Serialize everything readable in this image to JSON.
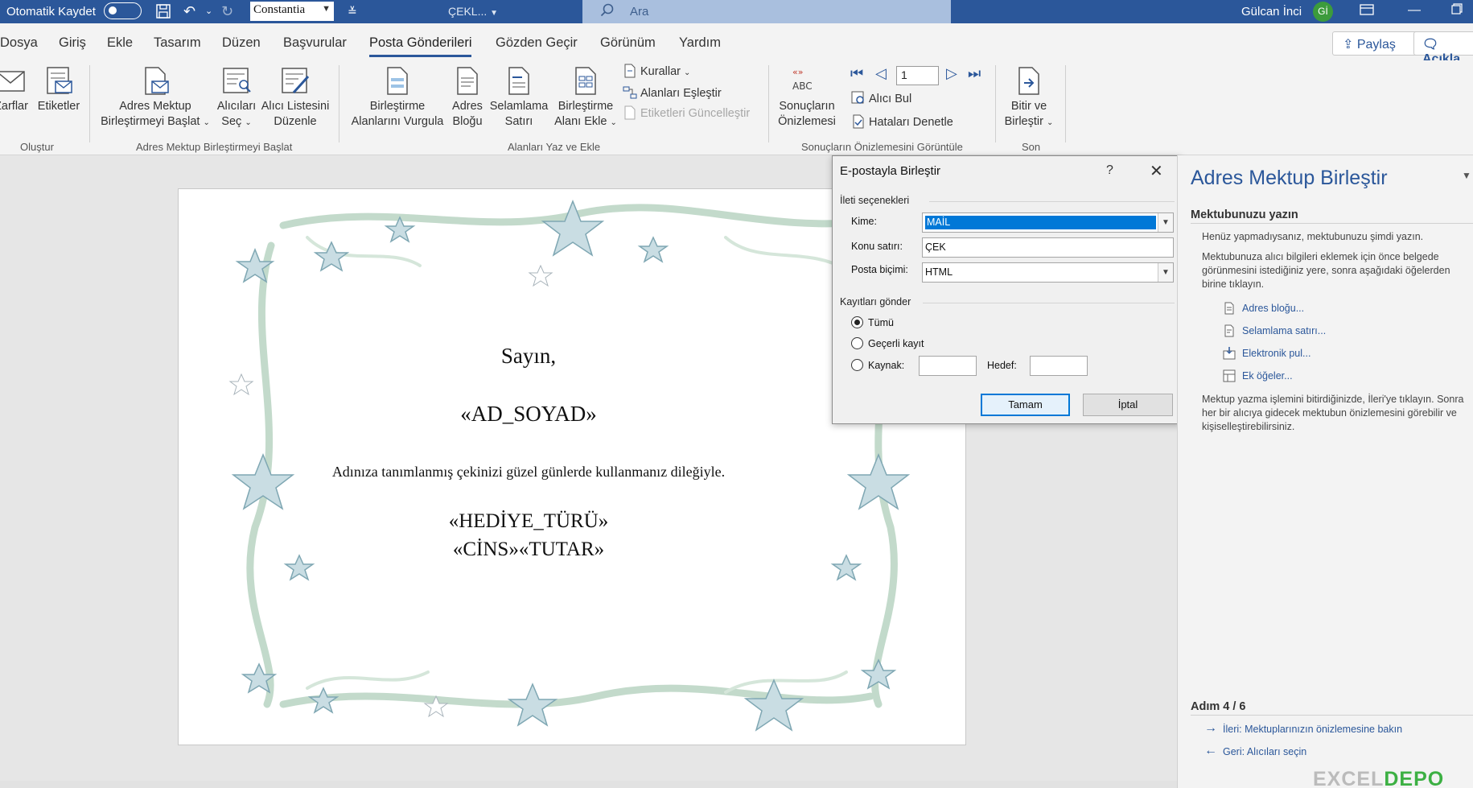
{
  "titlebar": {
    "autosave_label": "Otomatik Kaydet",
    "font_name": "Constantia",
    "doc_name": "ÇEKL...",
    "search_placeholder": "Ara",
    "user_name": "Gülcan İnci",
    "user_initials": "Gİ"
  },
  "tabs": [
    {
      "label": "Dosya"
    },
    {
      "label": "Giriş"
    },
    {
      "label": "Ekle"
    },
    {
      "label": "Tasarım"
    },
    {
      "label": "Düzen"
    },
    {
      "label": "Başvurular"
    },
    {
      "label": "Posta Gönderileri",
      "active": true
    },
    {
      "label": "Gözden Geçir"
    },
    {
      "label": "Görünüm"
    },
    {
      "label": "Yardım"
    }
  ],
  "header_actions": {
    "share": "Paylaş",
    "comments": "Açıkla"
  },
  "ribbon": {
    "create": {
      "envelopes": "Zarflar",
      "labels": "Etiketler",
      "group": "Oluştur"
    },
    "start": {
      "start_merge": [
        "Adres Mektup",
        "Birleştirmeyi Başlat"
      ],
      "select_recipients": [
        "Alıcıları",
        "Seç"
      ],
      "edit_list": [
        "Alıcı Listesini",
        "Düzenle"
      ],
      "group": "Adres Mektup Birleştirmeyi Başlat"
    },
    "write": {
      "highlight": [
        "Birleştirme",
        "Alanlarını Vurgula"
      ],
      "address_block": [
        "Adres",
        "Bloğu"
      ],
      "greeting_line": [
        "Selamlama",
        "Satırı"
      ],
      "insert_field": [
        "Birleştirme",
        "Alanı Ekle"
      ],
      "rules": "Kurallar",
      "match_fields": "Alanları Eşleştir",
      "update_labels": "Etiketleri Güncelleştir",
      "group": "Alanları Yaz ve Ekle"
    },
    "preview": {
      "preview_results": [
        "Sonuçların",
        "Önizlemesi"
      ],
      "record": "1",
      "find_recipient": "Alıcı Bul",
      "check_errors": "Hataları Denetle",
      "group": "Sonuçların Önizlemesini Görüntüle"
    },
    "finish": {
      "finish_merge": [
        "Bitir ve",
        "Birleştir"
      ],
      "group": "Son"
    }
  },
  "document": {
    "greeting": "Sayın,",
    "name_field": "«AD_SOYAD»",
    "body": "Adınıza tanımlanmış çekinizi güzel günlerde kullanmanız dileğiyle.",
    "gift_field": "«HEDİYE_TÜRÜ»",
    "amount_fields": "«CİNS»«TUTAR»"
  },
  "dialog": {
    "title": "E-postayla Birleştir",
    "help": "?",
    "message_options": "İleti seçenekleri",
    "to_label": "Kime:",
    "to_value": "MAİL",
    "subject_label": "Konu satırı:",
    "subject_value": "ÇEK",
    "format_label": "Posta biçimi:",
    "format_value": "HTML",
    "send_records": "Kayıtları gönder",
    "opt_all": "Tümü",
    "opt_current": "Geçerli kayıt",
    "opt_from": "Kaynak:",
    "opt_to": "Hedef:",
    "ok": "Tamam",
    "cancel": "İptal"
  },
  "taskpane": {
    "title": "Adres Mektup Birleştir",
    "heading": "Mektubunuzu yazın",
    "intro": "Henüz yapmadıysanız, mektubunuzu şimdi yazın.",
    "instructions": "Mektubunuza alıcı bilgileri eklemek için önce belgede görünmesini istediğiniz yere, sonra aşağıdaki öğelerden birine tıklayın.",
    "links": [
      "Adres bloğu...",
      "Selamlama satırı...",
      "Elektronik pul...",
      "Ek öğeler..."
    ],
    "outro": "Mektup yazma işlemini bitirdiğinizde, İleri'ye tıklayın. Sonra her bir alıcıya gidecek mektubun önizlemesini görebilir ve kişiselleştirebilirsiniz.",
    "step": "Adım 4 / 6",
    "next": "İleri: Mektuplarınızın önizlemesine bakın",
    "prev": "Geri: Alıcıları seçin"
  },
  "watermark": {
    "part1": "EXCEL",
    "part2": "DEPO"
  },
  "colors": {
    "accent": "#2b579a",
    "selection": "#0078d7"
  }
}
